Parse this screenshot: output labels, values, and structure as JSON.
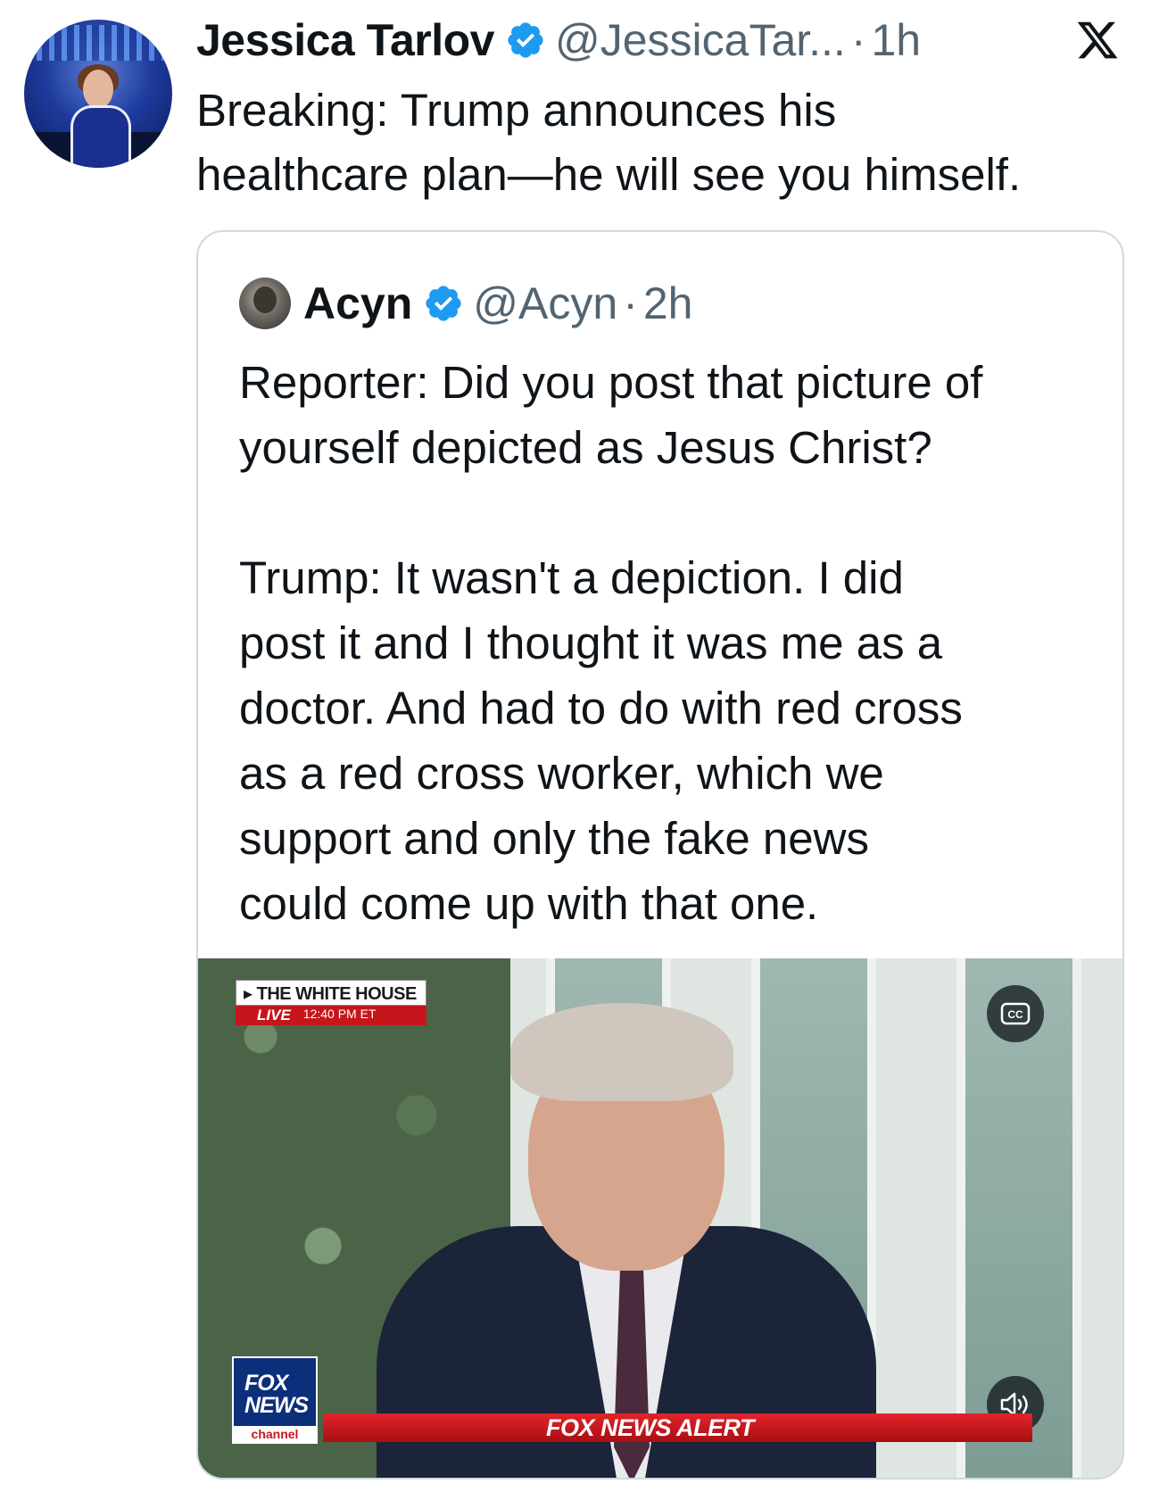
{
  "tweet": {
    "author_name": "Jessica Tarlov",
    "author_handle": "@JessicaTar...",
    "separator": "·",
    "time": "1h",
    "text": "Breaking: Trump announces his\nhealthcare plan—he will see you himself."
  },
  "quoted_tweet": {
    "author_name": "Acyn",
    "author_handle": "@Acyn",
    "separator": "·",
    "time": "2h",
    "text": "Reporter: Did you post that picture of\nyourself depicted as Jesus Christ?\n\nTrump: It wasn't a depiction. I did\npost it and I thought it was me as a\ndoctor. And had to do with red cross\nas a red cross worker, which we\nsupport and only the fake news\ncould come up with that one."
  },
  "video": {
    "lower_third_title": "THE WHITE HOUSE",
    "lower_third_live": "LIVE",
    "lower_third_time": "12:40 PM ET",
    "fox_logo_line1": "FOX",
    "fox_logo_line2": "NEWS",
    "fox_logo_channel": "channel",
    "alert_text": "FOX NEWS ALERT",
    "cc_label": "CC"
  },
  "icons": {
    "verified": "verified-badge-icon",
    "x_logo": "x-logo-icon",
    "captions": "closed-captions-icon",
    "sound": "speaker-icon"
  },
  "colors": {
    "verified_blue": "#1d9bf0",
    "secondary_text": "#536471",
    "border": "#cfd9de",
    "alert_red": "#c6161b"
  }
}
